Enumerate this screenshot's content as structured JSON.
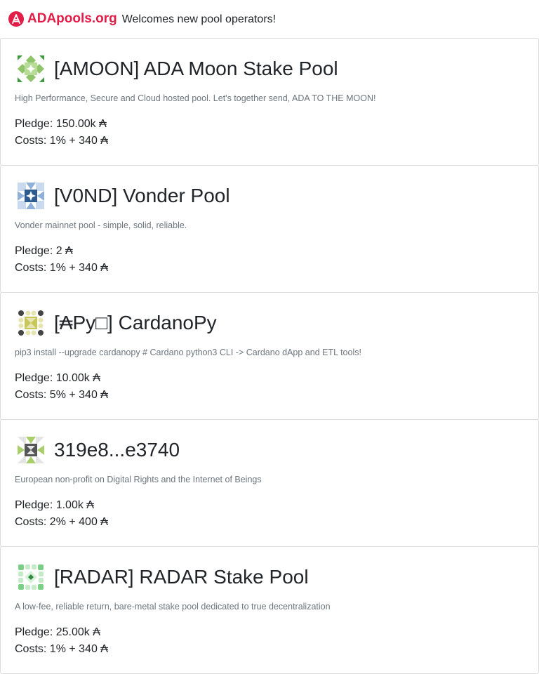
{
  "header": {
    "brand": "ADApools.org",
    "tagline": "Welcomes new pool operators!",
    "brand_color": "#e11d48"
  },
  "pools": [
    {
      "name": "[AMOON] ADA Moon Stake Pool",
      "description": "High Performance, Secure and Cloud hosted pool. Let's together send, ADA TO THE MOON!",
      "pledge": "Pledge: 150.00k ₳",
      "costs": "Costs: 1% + 340 ₳",
      "icon": "identicon-green-star"
    },
    {
      "name": "[V0ND] Vonder Pool",
      "description": "Vonder mainnet pool - simple, solid, reliable.",
      "pledge": "Pledge: 2 ₳",
      "costs": "Costs: 1% + 340 ₳",
      "icon": "identicon-blue-star"
    },
    {
      "name": "[₳Py□] CardanoPy",
      "description": "pip3 install --upgrade cardanopy # Cardano python3 CLI -> Cardano dApp and ETL tools!",
      "pledge": "Pledge: 10.00k ₳",
      "costs": "Costs: 5% + 340 ₳",
      "icon": "identicon-yellow-dots"
    },
    {
      "name": "319e8...e3740",
      "description": "European non-profit on Digital Rights and the Internet of Beings",
      "pledge": "Pledge: 1.00k ₳",
      "costs": "Costs: 2% + 400 ₳",
      "icon": "identicon-grey-x"
    },
    {
      "name": "[RADAR] RADAR Stake Pool",
      "description": "A low-fee, reliable return, bare-metal stake pool dedicated to true decentralization",
      "pledge": "Pledge: 25.00k ₳",
      "costs": "Costs: 1% + 340 ₳",
      "icon": "identicon-green-diamonds"
    }
  ]
}
